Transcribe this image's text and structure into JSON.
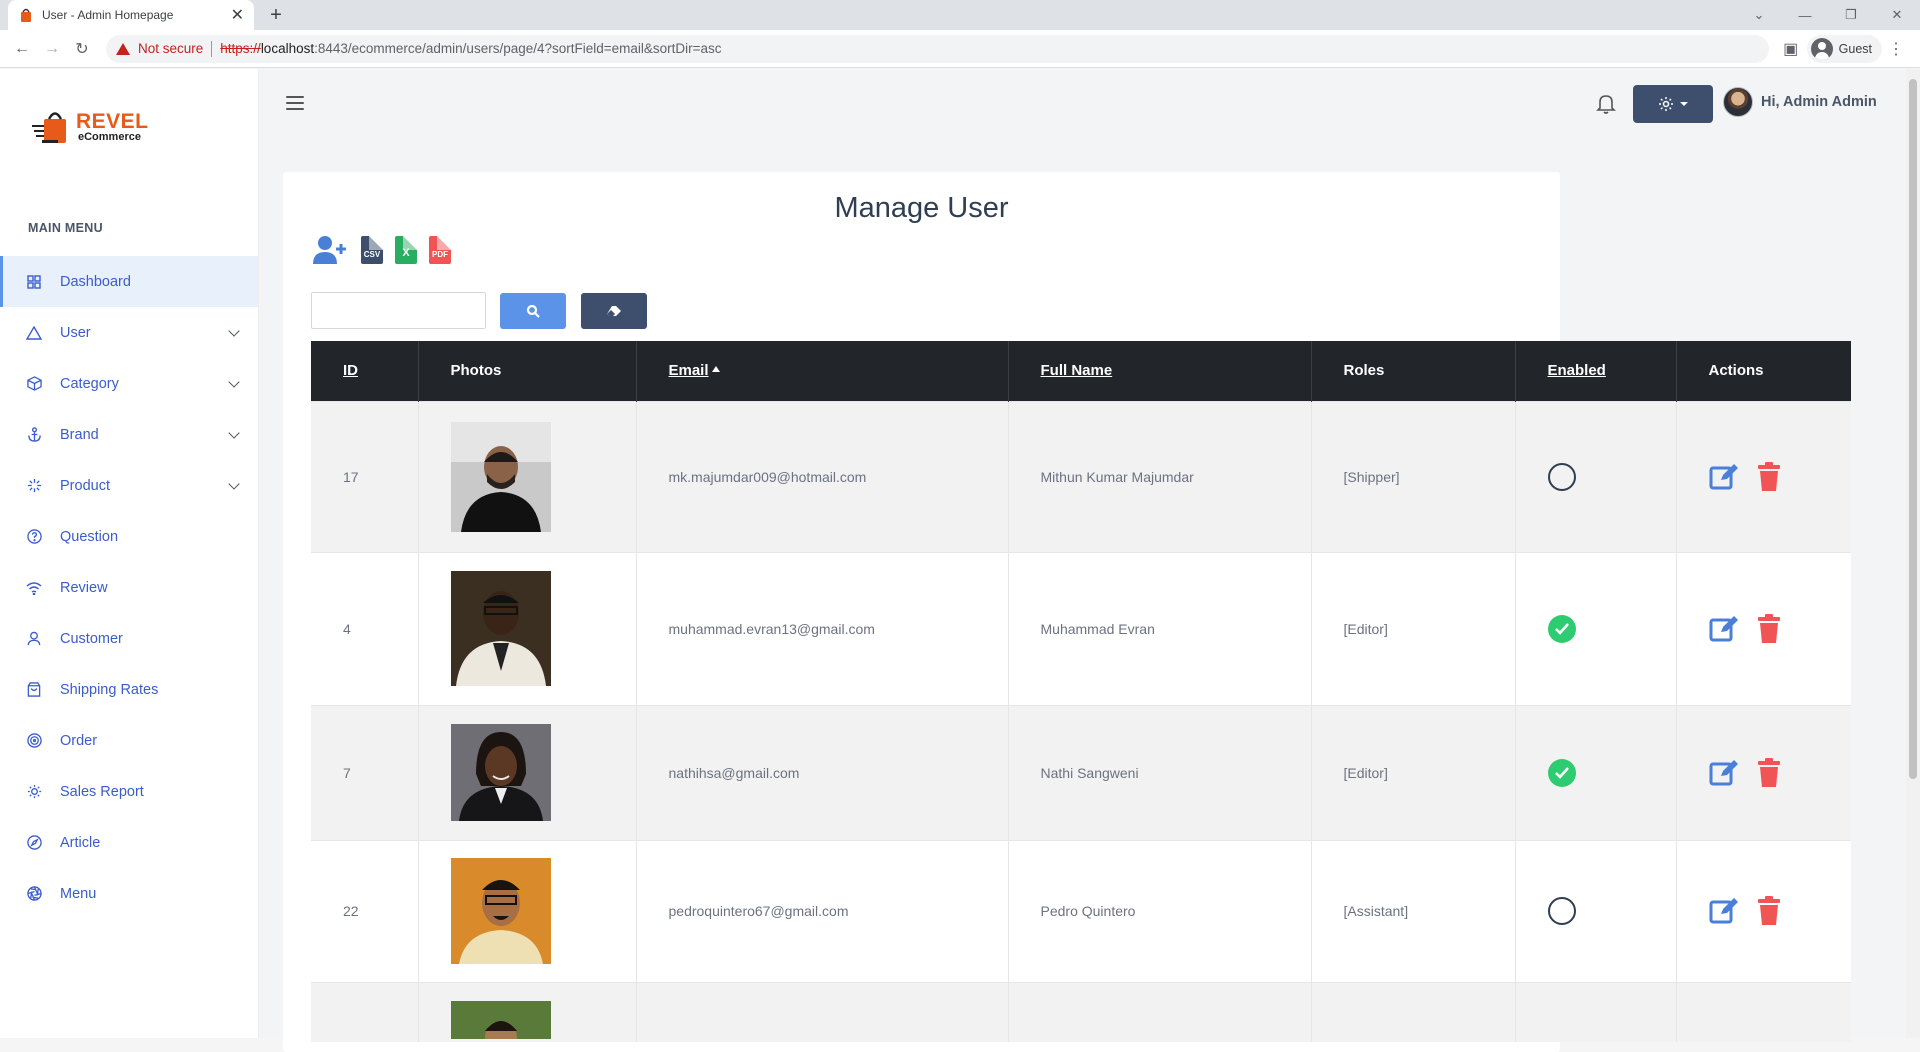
{
  "browser": {
    "tab_title": "User - Admin Homepage",
    "security_label": "Not secure",
    "url_scheme": "https://",
    "url_host": "localhost",
    "url_rest": ":8443/ecommerce/admin/users/page/4?sortField=email&sortDir=asc",
    "profile_label": "Guest"
  },
  "sidebar": {
    "brand_name": "REVEL",
    "brand_sub": "eCommerce",
    "menu_heading": "MAIN MENU",
    "items": [
      {
        "label": "Dashboard",
        "icon": "grid-icon"
      },
      {
        "label": "User",
        "icon": "triangle-icon"
      },
      {
        "label": "Category",
        "icon": "box-icon"
      },
      {
        "label": "Brand",
        "icon": "anchor-icon"
      },
      {
        "label": "Product",
        "icon": "sparkle-icon"
      },
      {
        "label": "Question",
        "icon": "help-circle-icon"
      },
      {
        "label": "Review",
        "icon": "wifi-icon"
      },
      {
        "label": "Customer",
        "icon": "user-icon"
      },
      {
        "label": "Shipping Rates",
        "icon": "shopping-bag-icon"
      },
      {
        "label": "Order",
        "icon": "target-icon"
      },
      {
        "label": "Sales Report",
        "icon": "sun-icon"
      },
      {
        "label": "Article",
        "icon": "compass-icon"
      },
      {
        "label": "Menu",
        "icon": "aperture-icon"
      }
    ]
  },
  "header": {
    "greeting": "Hi, Admin Admin"
  },
  "main": {
    "title": "Manage User",
    "export_icons": {
      "csv": "CSV",
      "excel": "X",
      "pdf": "PDF"
    },
    "search": {
      "value": "",
      "placeholder": ""
    },
    "table": {
      "columns": [
        "ID",
        "Photos",
        "Email",
        "Full Name",
        "Roles",
        "Enabled",
        "Actions"
      ],
      "rows": [
        {
          "id": "17",
          "email": "mk.majumdar009@hotmail.com",
          "name": "Mithun Kumar Majumdar",
          "roles": "[Shipper]",
          "enabled": false
        },
        {
          "id": "4",
          "email": "muhammad.evran13@gmail.com",
          "name": "Muhammad Evran",
          "roles": "[Editor]",
          "enabled": true
        },
        {
          "id": "7",
          "email": "nathihsa@gmail.com",
          "name": "Nathi Sangweni",
          "roles": "[Editor]",
          "enabled": true
        },
        {
          "id": "22",
          "email": "pedroquintero67@gmail.com",
          "name": "Pedro Quintero",
          "roles": "[Assistant]",
          "enabled": false
        }
      ]
    }
  },
  "colors": {
    "accent": "#5b93e8",
    "dark_button": "#3d4f6d",
    "brand": "#e85a1a",
    "enabled_green": "#2ecc71",
    "delete_red": "#f05454"
  }
}
